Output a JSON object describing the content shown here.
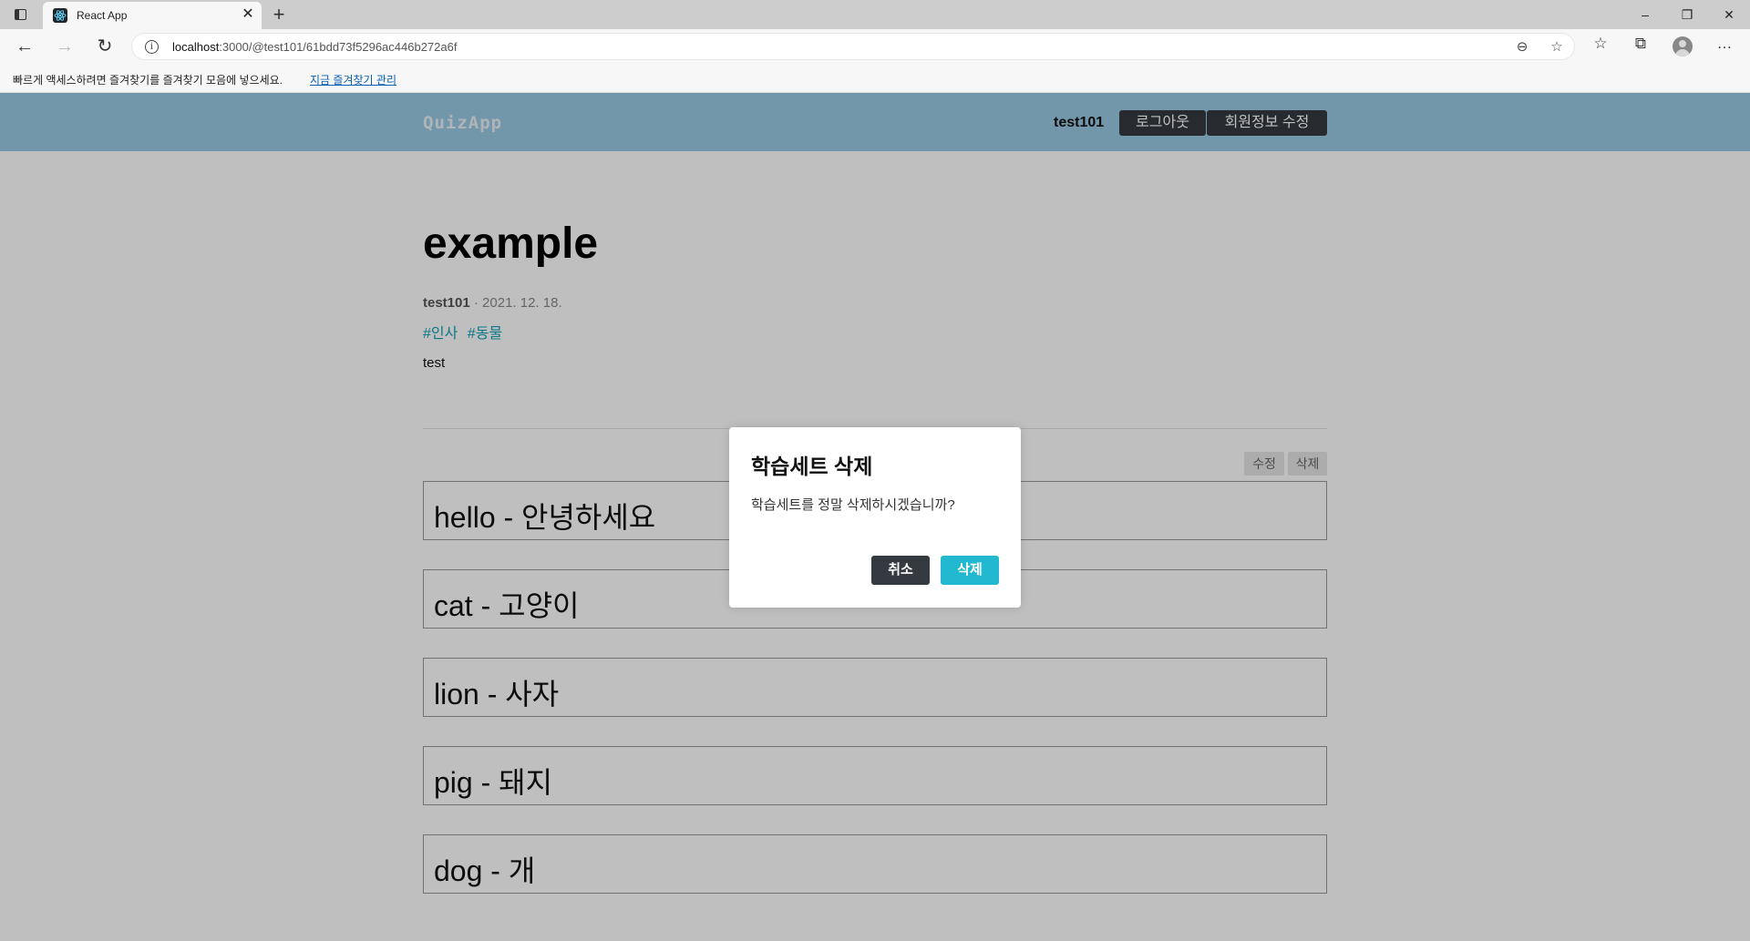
{
  "browser": {
    "tab_title": "React App",
    "url_host": "localhost",
    "url_path": ":3000/@test101/61bdd73f5296ac446b272a6f",
    "favorites_bar_message": "빠르게 액세스하려면 즐겨찾기를 즐겨찾기 모음에 넣으세요.",
    "favorites_bar_link": "지금 즐겨찾기 관리",
    "icons": {
      "tab_actions": "tab-actions-icon",
      "close": "close-icon",
      "new_tab": "plus-icon",
      "back": "back-arrow-icon",
      "forward": "forward-arrow-icon",
      "refresh": "refresh-icon",
      "site_info": "info-icon",
      "zoom": "zoom-out-icon",
      "add_favorite": "star-add-icon",
      "favorites": "favorites-list-icon",
      "collections": "collections-icon",
      "profile": "profile-avatar-icon",
      "more": "more-dots-icon"
    }
  },
  "header": {
    "logo": "QuizApp",
    "username": "test101",
    "logout_label": "로그아웃",
    "edit_profile_label": "회원정보 수정",
    "bg_color": "#99c8e3",
    "button_color": "#343a40"
  },
  "post": {
    "title": "example",
    "author": "test101",
    "separator": "·",
    "date": "2021. 12. 18.",
    "tags": [
      "#인사",
      "#동물"
    ],
    "description": "test",
    "edit_label": "수정",
    "delete_label": "삭제",
    "cards": [
      "hello - 안녕하세요",
      "cat - 고양이",
      "lion - 사자",
      "pig - 돼지",
      "dog - 개"
    ]
  },
  "modal": {
    "title": "학습세트 삭제",
    "message": "학습세트를 정말 삭제하시겠습니까?",
    "cancel_label": "취소",
    "confirm_label": "삭제",
    "cancel_color": "#343a40",
    "confirm_color": "#22b8cf"
  }
}
